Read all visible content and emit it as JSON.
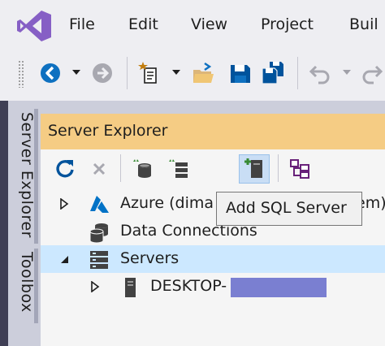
{
  "menubar": {
    "items": [
      "File",
      "Edit",
      "View",
      "Project",
      "Buil"
    ]
  },
  "toolbar": {
    "icons": [
      "back-icon",
      "forward-icon",
      "new-project-icon",
      "open-folder-icon",
      "save-icon",
      "save-all-icon",
      "undo-icon",
      "redo-icon"
    ]
  },
  "sidebar": {
    "tabs": [
      "Server Explorer",
      "Toolbox"
    ]
  },
  "server_explorer": {
    "title": "Server Explorer",
    "toolbar_icons": [
      "refresh-icon",
      "stop-icon",
      "connect-database-icon",
      "connect-server-icon",
      "add-sql-server-icon",
      "view-sql-dependency-icon"
    ],
    "tooltip": "Add SQL Server",
    "tree": [
      {
        "label": "Azure (dima",
        "label_tail": "em)",
        "icon": "azure-icon",
        "expanded": false
      },
      {
        "label": "Data Connections",
        "icon": "data-connections-icon",
        "expanded": null
      },
      {
        "label": "Servers",
        "icon": "servers-icon",
        "expanded": true,
        "selected": true
      },
      {
        "label": "DESKTOP-",
        "icon": "server-icon",
        "expanded": false
      }
    ]
  },
  "colors": {
    "vs_purple": "#865fc5",
    "panel_title": "#f5cc84",
    "selection": "#cce8ff",
    "accent_blue": "#0e70c0",
    "redaction": "#7a7fd1"
  }
}
